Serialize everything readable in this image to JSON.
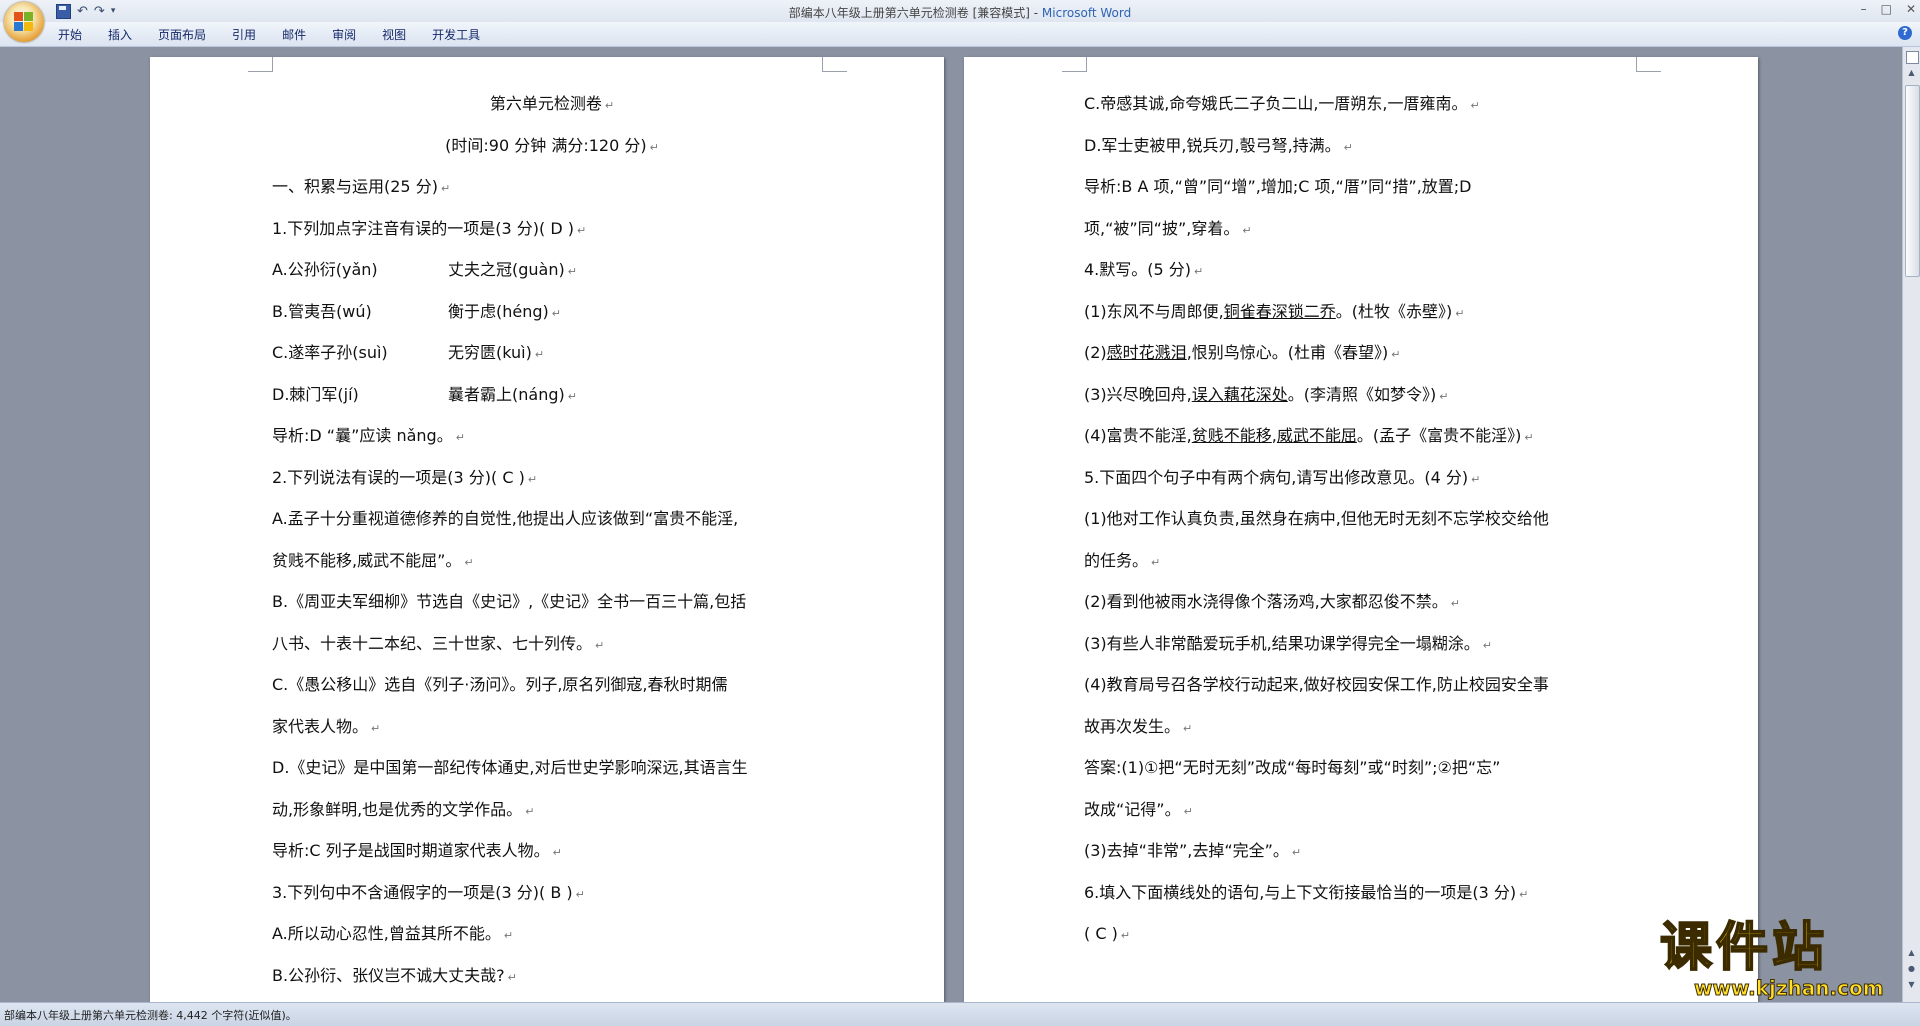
{
  "window": {
    "doc_title": "部编本八年级上册第六单元检测卷 [兼容模式] - ",
    "app_name": "Microsoft Word",
    "controls": [
      "–",
      "□",
      "✕"
    ]
  },
  "ribbon": {
    "tabs": [
      "开始",
      "插入",
      "页面布局",
      "引用",
      "邮件",
      "审阅",
      "视图",
      "开发工具"
    ],
    "help": "?"
  },
  "left_page": {
    "title": "第六单元检测卷",
    "subtitle": "(时间:90 分钟   满分:120 分)",
    "lines": [
      "一、积累与运用(25 分)",
      "1.下列加点字注音有误的一项是(3 分)(  D  )",
      [
        "A.公孙衍(yǎn)",
        "丈夫之冠(guàn)"
      ],
      [
        "B.管夷吾(wú)",
        "衡于虑(héng)"
      ],
      [
        "C.遂率子孙(suì)",
        "无穷匮(kuì)"
      ],
      [
        "D.棘门军(jí)",
        "曩者霸上(náng)"
      ],
      "导析:D  “曩”应读 nǎng。",
      "2.下列说法有误的一项是(3 分)(  C  )",
      "A.孟子十分重视道德修养的自觉性,他提出人应该做到“富贵不能淫,",
      "贫贱不能移,威武不能屈”。",
      "B.《周亚夫军细柳》节选自《史记》,《史记》全书一百三十篇,包括",
      "八书、十表十二本纪、三十世家、七十列传。",
      "C.《愚公移山》选自《列子·汤问》。列子,原名列御寇,春秋时期儒",
      "家代表人物。",
      "D.《史记》是中国第一部纪传体通史,对后世史学影响深远,其语言生",
      "动,形象鲜明,也是优秀的文学作品。",
      "导析:C  列子是战国时期道家代表人物。",
      "3.下列句中不含通假字的一项是(3 分)(  B  )",
      "A.所以动心忍性,曾益其所不能。",
      "B.公孙衍、张仪岂不诚大丈夫哉?"
    ]
  },
  "right_page": {
    "lines": [
      "C.帝感其诚,命夸娥氏二子负二山,一厝朔东,一厝雍南。",
      "D.军士吏被甲,锐兵刃,彀弓弩,持满。",
      "导析:B  A 项,“曾”同“增”,增加;C 项,“厝”同“措”,放置;D",
      "项,“被”同“披”,穿着。",
      "4.默写。(5 分)",
      [
        "(1)东风不与周郎便,",
        "铜雀春深锁二乔",
        "。(杜牧《赤壁》)"
      ],
      [
        "(2)",
        "感时花溅泪",
        ",恨别鸟惊心。(杜甫《春望》)"
      ],
      [
        "(3)兴尽晚回舟,",
        "误入藕花深处",
        "。(李清照《如梦令》)"
      ],
      [
        "(4)富贵不能淫,",
        "贫贱不能移",
        ",",
        "威武不能屈",
        "。(孟子《富贵不能淫》)"
      ],
      "5.下面四个句子中有两个病句,请写出修改意见。(4 分)",
      "(1)他对工作认真负责,虽然身在病中,但他无时无刻不忘学校交给他",
      "的任务。",
      "(2)看到他被雨水浇得像个落汤鸡,大家都忍俊不禁。",
      "(3)有些人非常酷爱玩手机,结果功课学得完全一塌糊涂。",
      "(4)教育局号召各学校行动起来,做好校园安保工作,防止校园安全事",
      "故再次发生。",
      "答案:(1)①把“无时无刻”改成“每时每刻”或“时刻”;②把“忘”",
      "改成“记得”。",
      "(3)去掉“非常”,去掉“完全”。",
      "6.填入下面横线处的语句,与上下文衔接最恰当的一项是(3 分)",
      "(  C  )"
    ]
  },
  "status_bar": {
    "text": "部编本八年级上册第六单元检测卷: 4,442 个字符(近似值)。"
  },
  "watermark": {
    "cn": "课件站",
    "url": "www.kjzhan.com"
  },
  "colors": {
    "workspace": "#8b93a3",
    "ribbon": "#dbe4f0",
    "title_accent": "#2e63b4",
    "watermark": "#f6d20a"
  }
}
